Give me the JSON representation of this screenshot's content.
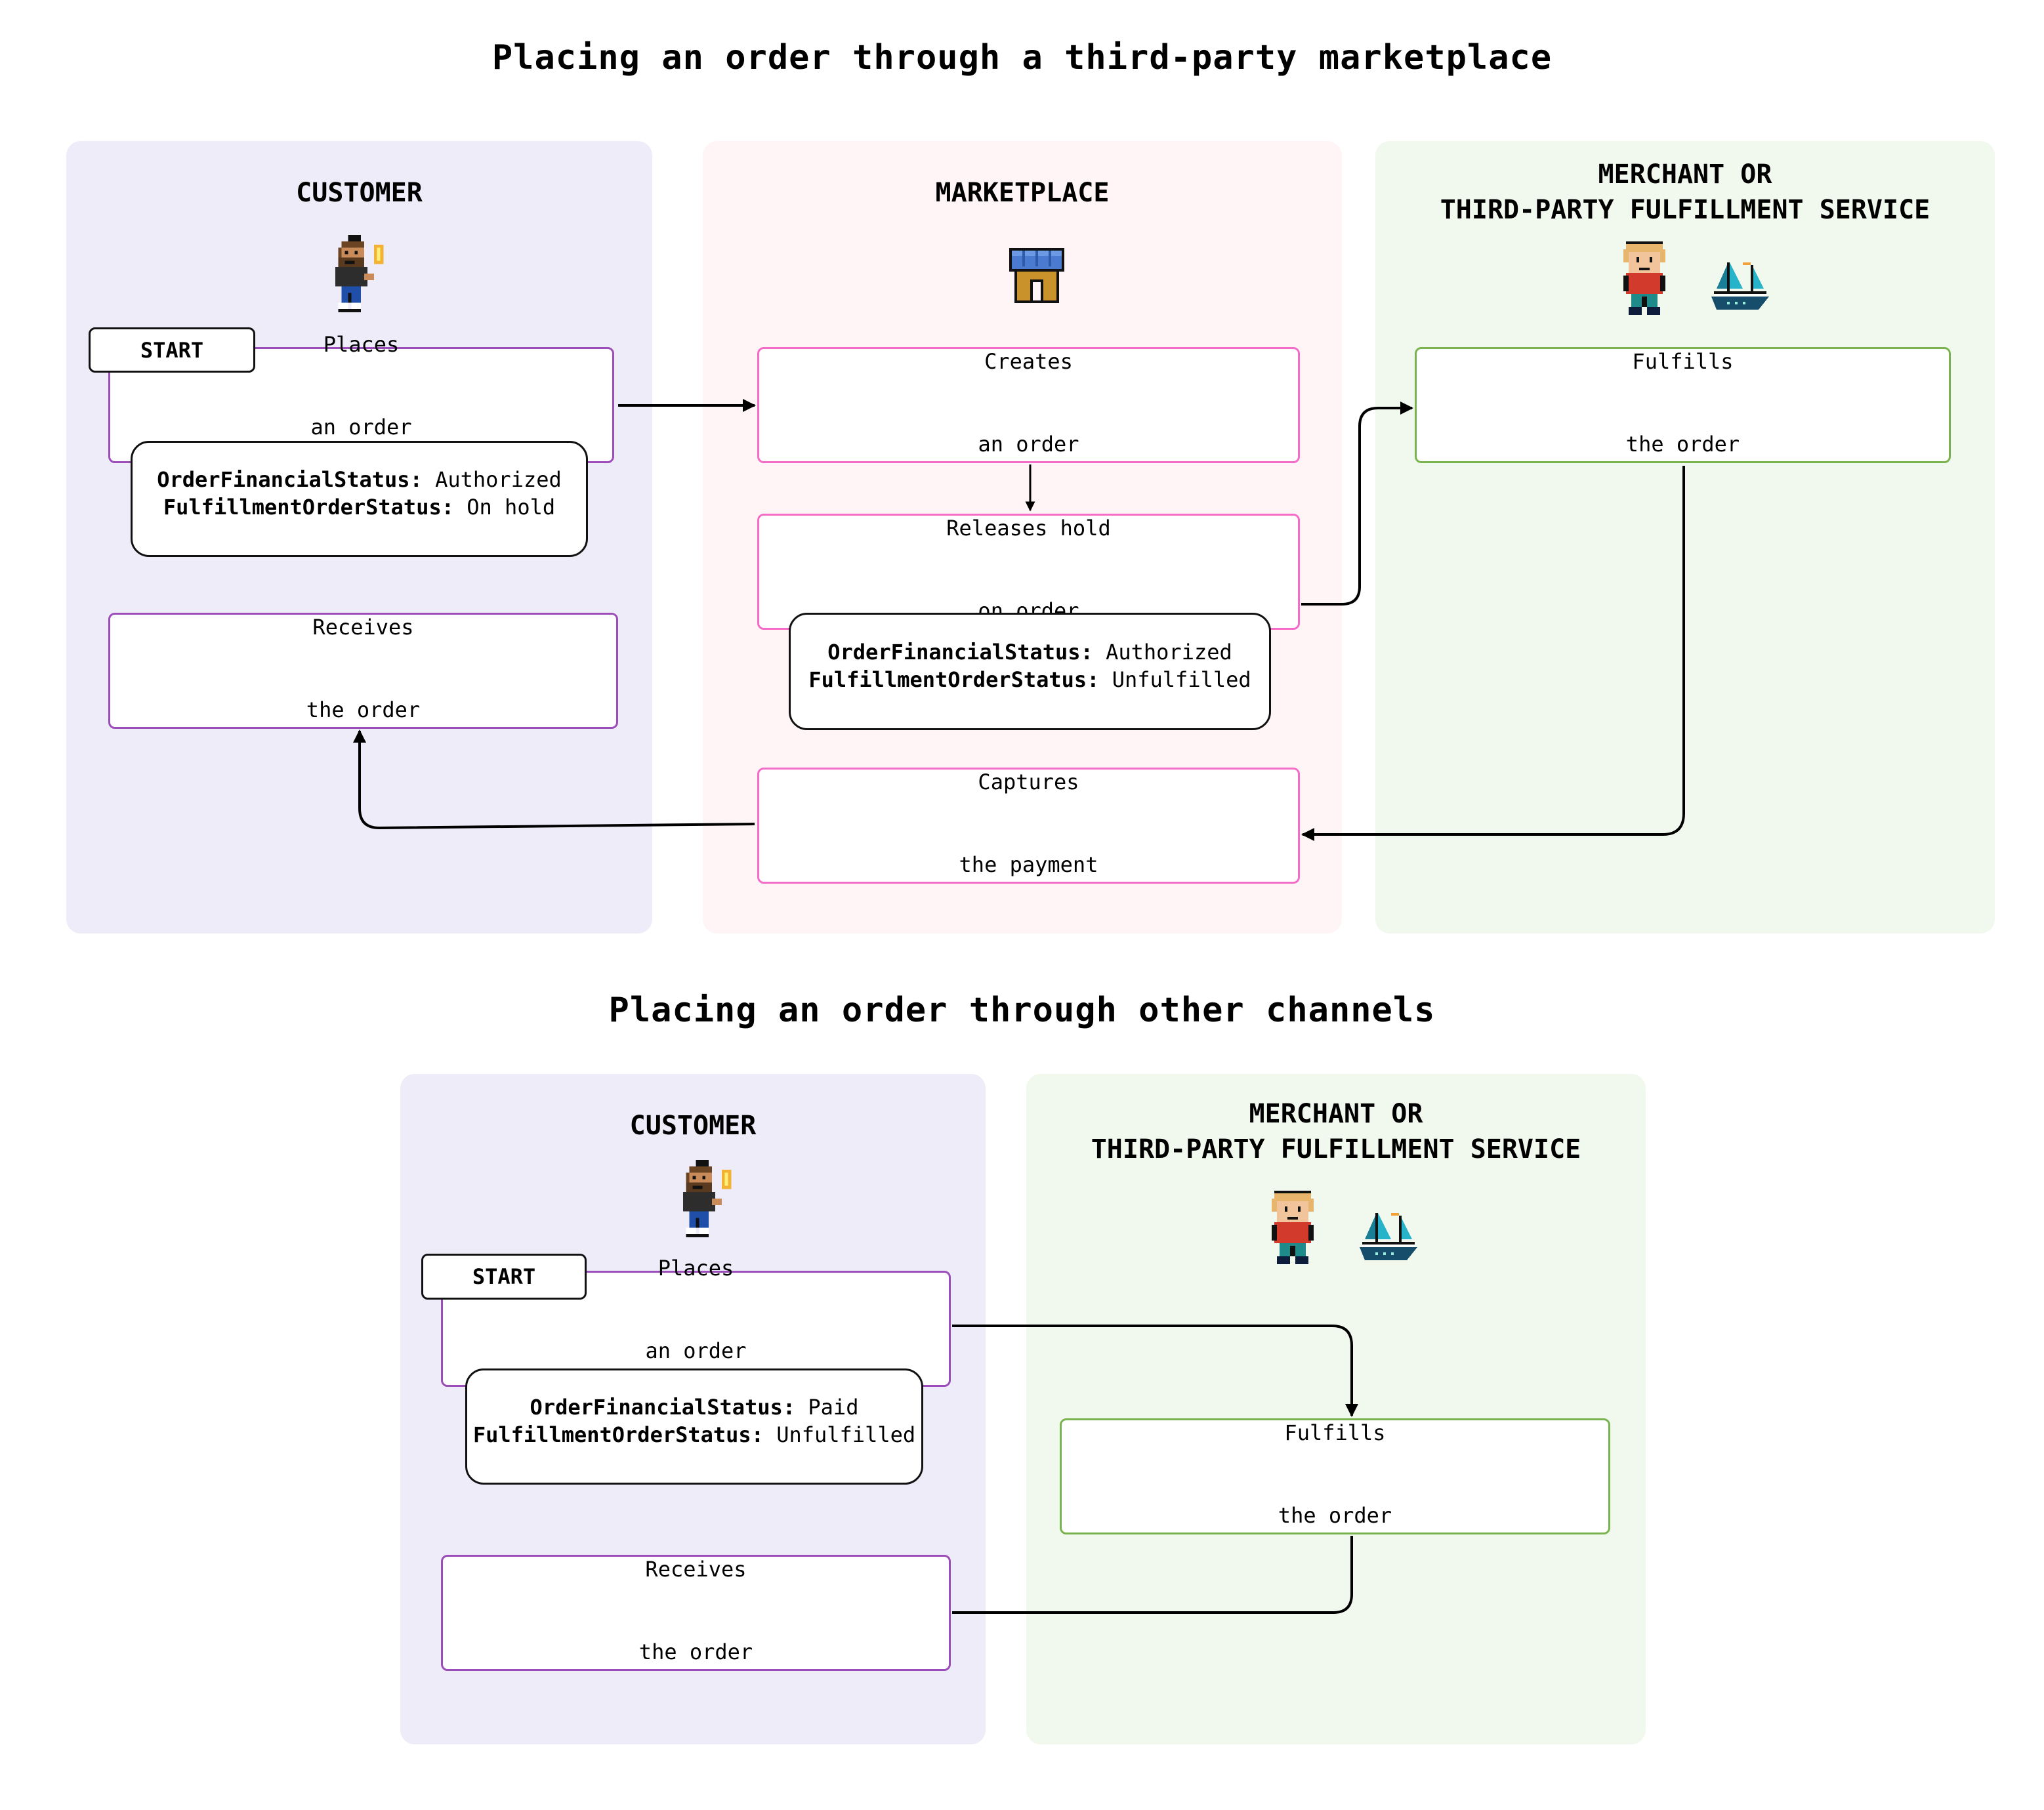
{
  "diagram_1": {
    "title": "Placing an order through a third-party marketplace",
    "lanes": {
      "customer": {
        "title": "CUSTOMER",
        "icon": "customer-avatar-icon"
      },
      "marketplace": {
        "title": "MARKETPLACE",
        "icon": "storefront-icon"
      },
      "merchant": {
        "title_line1": "MERCHANT OR",
        "title_line2": "THIRD-PARTY FULFILLMENT SERVICE",
        "icons": [
          "merchant-avatar-icon",
          "sailboat-icon"
        ]
      }
    },
    "start_label": "START",
    "steps": {
      "places_order": {
        "line1": "Places",
        "line2": "an order"
      },
      "receives_order": {
        "line1": "Receives",
        "line2": "the order"
      },
      "creates_order": {
        "line1": "Creates",
        "line2": "an order"
      },
      "releases_hold": {
        "line1": "Releases hold",
        "line2": "on order"
      },
      "captures_payment": {
        "line1": "Captures",
        "line2": "the payment"
      },
      "fulfills_order": {
        "line1": "Fulfills",
        "line2": "the order"
      }
    },
    "status_customer": {
      "financial_key": "OrderFinancialStatus:",
      "financial_value": "Authorized",
      "fulfillment_key": "FulfillmentOrderStatus:",
      "fulfillment_value": "On hold"
    },
    "status_marketplace": {
      "financial_key": "OrderFinancialStatus:",
      "financial_value": "Authorized",
      "fulfillment_key": "FulfillmentOrderStatus:",
      "fulfillment_value": "Unfulfilled"
    }
  },
  "diagram_2": {
    "title": "Placing an order through other channels",
    "lanes": {
      "customer": {
        "title": "CUSTOMER",
        "icon": "customer-avatar-icon"
      },
      "merchant": {
        "title_line1": "MERCHANT OR",
        "title_line2": "THIRD-PARTY FULFILLMENT SERVICE",
        "icons": [
          "merchant-avatar-icon",
          "sailboat-icon"
        ]
      }
    },
    "start_label": "START",
    "steps": {
      "places_order": {
        "line1": "Places",
        "line2": "an order"
      },
      "receives_order": {
        "line1": "Receives",
        "line2": "the order"
      },
      "fulfills_order": {
        "line1": "Fulfills",
        "line2": "the order"
      }
    },
    "status_customer": {
      "financial_key": "OrderFinancialStatus:",
      "financial_value": "Paid",
      "fulfillment_key": "FulfillmentOrderStatus:",
      "fulfillment_value": "Unfulfilled"
    }
  },
  "colors": {
    "customer_lane_bg": "#efecfa",
    "marketplace_lane_bg": "#fff4f6",
    "merchant_lane_bg": "#f1f9ee",
    "customer_box_border": "#9b4dba",
    "marketplace_box_border": "#f56cc8",
    "merchant_box_border": "#79b34d",
    "arrow": "#000000"
  }
}
